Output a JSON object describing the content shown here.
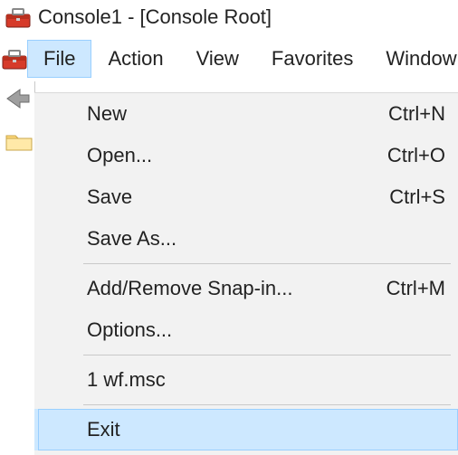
{
  "window": {
    "title": "Console1 - [Console Root]"
  },
  "menubar": {
    "items": [
      {
        "label": "File",
        "open": true
      },
      {
        "label": "Action",
        "open": false
      },
      {
        "label": "View",
        "open": false
      },
      {
        "label": "Favorites",
        "open": false
      },
      {
        "label": "Window",
        "open": false
      }
    ]
  },
  "file_menu": {
    "items": [
      {
        "label": "New",
        "shortcut": "Ctrl+N"
      },
      {
        "label": "Open...",
        "shortcut": "Ctrl+O"
      },
      {
        "label": "Save",
        "shortcut": "Ctrl+S"
      },
      {
        "label": "Save As...",
        "shortcut": ""
      }
    ],
    "items2": [
      {
        "label": "Add/Remove Snap-in...",
        "shortcut": "Ctrl+M"
      },
      {
        "label": "Options...",
        "shortcut": ""
      }
    ],
    "items3": [
      {
        "label": "1 wf.msc",
        "shortcut": ""
      }
    ],
    "items4": [
      {
        "label": "Exit",
        "shortcut": "",
        "hover": true
      }
    ]
  }
}
